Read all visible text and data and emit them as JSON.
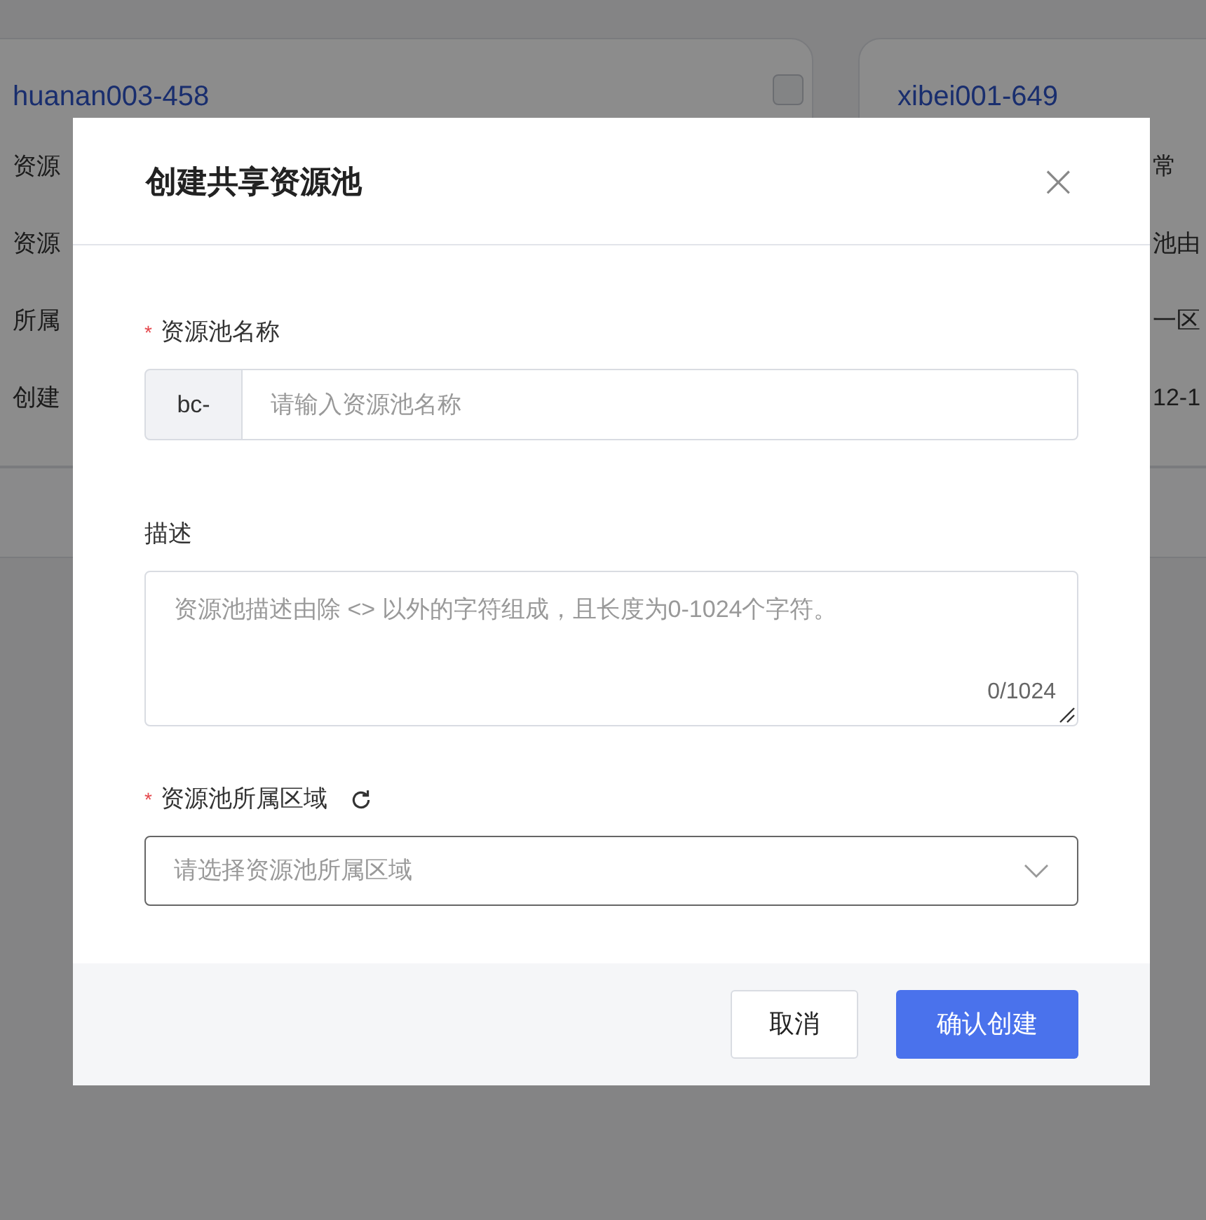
{
  "background_cards": [
    {
      "title": "huanan003-458",
      "checkbox": {
        "checked": false
      },
      "rows": [
        "资源",
        "资源",
        "所属",
        "创建"
      ]
    },
    {
      "title": "xibei001-649",
      "rows": [
        "常",
        "池由",
        "一区",
        "12-1"
      ]
    }
  ],
  "dialog": {
    "title": "创建共享资源池",
    "close": "×",
    "fields": [
      {
        "kind": "prefixed-input",
        "label": "资源池名称",
        "required_mark": "*",
        "prefix": "bc-",
        "placeholder": "请输入资源池名称"
      },
      {
        "kind": "textarea",
        "label": "描述",
        "placeholder": "资源池描述由除 <> 以外的字符组成，且长度为0-1024个字符。",
        "counter": "0/1024"
      },
      {
        "kind": "select",
        "label": "资源池所属区域",
        "required_mark": "*",
        "refresh": true,
        "placeholder": "请选择资源池所属区域"
      }
    ],
    "buttons": [
      {
        "label": "取消",
        "kind": "secondary"
      },
      {
        "label": "确认创建",
        "kind": "primary"
      }
    ]
  }
}
